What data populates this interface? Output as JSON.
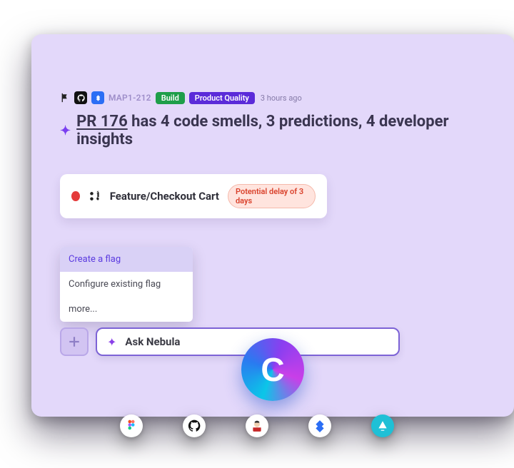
{
  "meta": {
    "ticket": "MAP1-212",
    "build_label": "Build",
    "pq_label": "Product Quality",
    "timestamp": "3 hours ago"
  },
  "headline": {
    "pr_link": "PR 176",
    "rest": "has 4 code smells, 3 predictions, 4 developer insights"
  },
  "feature": {
    "name": "Feature/Checkout Cart",
    "delay": "Potential delay of 3 days"
  },
  "menu": {
    "items": [
      "Create a flag",
      "Configure existing flag",
      "more..."
    ]
  },
  "ask": {
    "placeholder": "Ask Nebula"
  },
  "tray": {
    "items": [
      "figma",
      "github",
      "jenkins",
      "jira",
      "teal-app"
    ]
  }
}
